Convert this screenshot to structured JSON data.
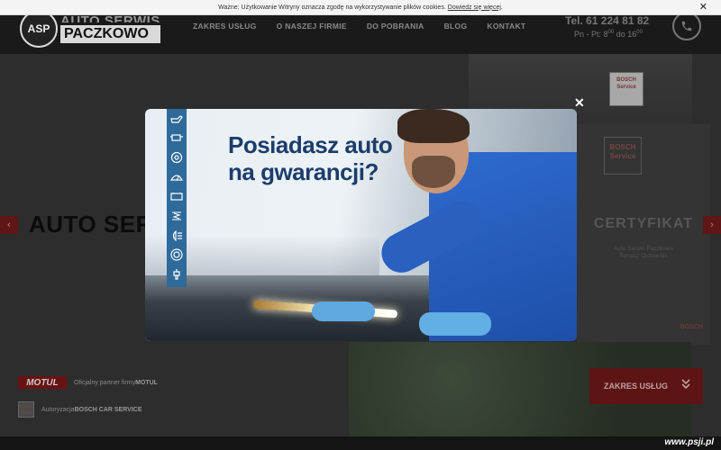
{
  "cookie": {
    "text": "Ważne: Użytkowanie Witryny oznacza zgodę na wykorzystywanie plików cookies.",
    "link": "Dowiedz się więcej",
    "link_suffix": ".",
    "close": "✕"
  },
  "header": {
    "logo_badge": "ASP",
    "logo_line1": "AUTO SERWIS",
    "logo_line2": "PACZKOWO",
    "nav": [
      "ZAKRES USŁUG",
      "O NASZEJ FIRMIE",
      "DO POBRANIA",
      "BLOG",
      "KONTAKT"
    ],
    "phone": "Tel. 61 224 81 82",
    "hours_prefix": "Pn - Pt: 8",
    "hours_open_min": "00",
    "hours_mid": " do 16",
    "hours_close_min": "00"
  },
  "hero": {
    "title": "AUTO SER",
    "arrow_left": "‹",
    "arrow_right": "›",
    "sign_text": "BOSCH Service",
    "cert_badge": "BOSCH Service",
    "cert_title": "CERTYFIKAT",
    "cert_name1": "Auto Serwis Paczkowa",
    "cert_name2": "Tomasz Cichowlas",
    "cert_brand": "BOSCH"
  },
  "partners": [
    {
      "logo": "MOTUL",
      "prefix": "Oficjalny partner firmy ",
      "name": "MOTUL"
    },
    {
      "logo": "BOSCH Service",
      "prefix": "Autoryzacja ",
      "name": "BOSCH CAR SERVICE"
    }
  ],
  "scope_button": {
    "label": "ZAKRES USŁUG",
    "chevron": "»"
  },
  "modal": {
    "headline_line1": "Posiadasz auto",
    "headline_line2": "na gwarancji?",
    "close": "✕",
    "icons": [
      "oil-can-icon",
      "engine-icon",
      "brake-disc-icon",
      "windshield-icon",
      "battery-icon",
      "suspension-icon",
      "headlight-icon",
      "tire-icon",
      "spark-plug-icon"
    ]
  },
  "watermark": "www.psji.pl",
  "colors": {
    "accent": "#5e1616",
    "modal_headline": "#1c3d6b",
    "icon_strip": "#2e6a9a"
  }
}
